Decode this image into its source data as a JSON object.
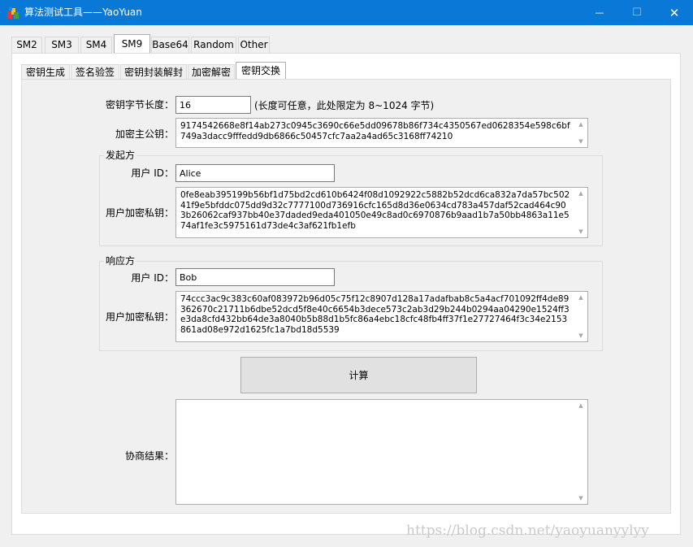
{
  "window": {
    "title": "算法测试工具——YaoYuan",
    "minimize_glyph": "—",
    "maximize_glyph": "☐",
    "close_glyph": "✕",
    "titlebar_color": "#0a78d7"
  },
  "main_tabs": [
    {
      "label": "SM2",
      "active": false
    },
    {
      "label": "SM3",
      "active": false
    },
    {
      "label": "SM4",
      "active": false
    },
    {
      "label": "SM9",
      "active": true
    },
    {
      "label": "Base64",
      "active": false
    },
    {
      "label": "Random",
      "active": false
    },
    {
      "label": "Other",
      "active": false
    }
  ],
  "sub_tabs": [
    {
      "label": "密钥生成",
      "active": false
    },
    {
      "label": "签名验签",
      "active": false
    },
    {
      "label": "密钥封装解封",
      "active": false
    },
    {
      "label": "加密解密",
      "active": false
    },
    {
      "label": "密钥交换",
      "active": true
    }
  ],
  "form": {
    "key_length_label": "密钥字节长度：",
    "key_length_value": "16",
    "key_length_hint": "(长度可任意，此处限定为 8~1024 字节)",
    "master_pubkey_label": "加密主公钥：",
    "master_pubkey_value": "9174542668e8f14ab273c0945c3690c66e5dd09678b86f734c4350567ed0628354e598c6bf749a3dacc9fffedd9db6866c50457cfc7aa2a4ad65c3168ff74210"
  },
  "initiator": {
    "title": "发起方",
    "user_id_label": "用户 ID：",
    "user_id_value": "Alice",
    "private_key_label": "用户加密私钥：",
    "private_key_value": "0fe8eab395199b56bf1d75bd2cd610b6424f08d1092922c5882b52dcd6ca832a7da57bc50241f9e5bfddc075dd9d32c7777100d736916cfc165d8d36e0634cd783a457daf52cad464c903b26062caf937bb40e37daded9eda401050e49c8ad0c6970876b9aad1b7a50bb4863a11e574af1fe3c5975161d73de4c3af621fb1efb"
  },
  "responder": {
    "title": "响应方",
    "user_id_label": "用户 ID：",
    "user_id_value": "Bob",
    "private_key_label": "用户加密私钥：",
    "private_key_value": "74ccc3ac9c383c60af083972b96d05c75f12c8907d128a17adafbab8c5a4acf701092ff4de89362670c21711b6dbe52dcd5f8e40c6654b3dece573c2ab3d29b244b0294aa04290e1524ff3e3da8cfd432bb64de3a8040b5b88d1b5fc86a4ebc18cfc48fb4ff37f1e27727464f3c34e2153861ad08e972d1625fc1a7bd18d5539"
  },
  "compute_button_label": "计算",
  "result": {
    "label": "协商结果：",
    "value": ""
  },
  "scroll_glyphs": {
    "up": "▲",
    "down": "▼"
  },
  "watermark": "https://blog.csdn.net/yaoyuanyylyy"
}
